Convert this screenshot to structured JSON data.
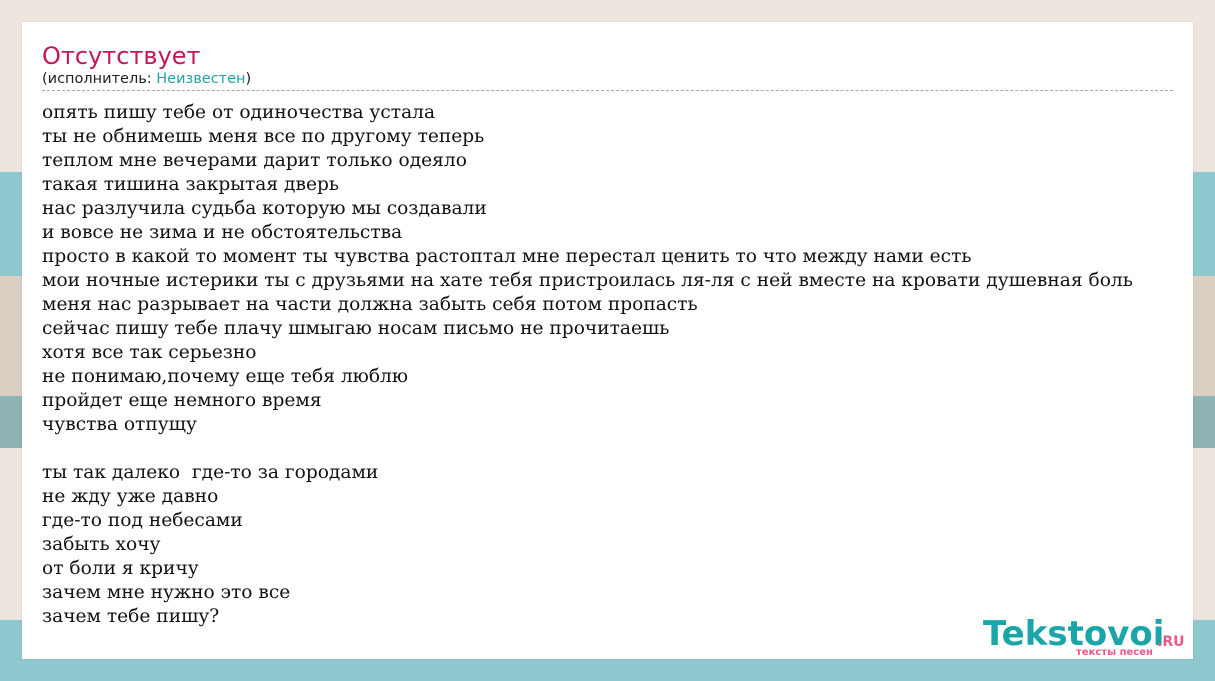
{
  "song": {
    "title": "Отсутствует",
    "artist_prefix": "(исполнитель: ",
    "artist": "Неизвестен",
    "artist_suffix": ")"
  },
  "lyrics": [
    "опять пишу тебе от одиночества устала",
    "ты не обнимешь меня все по другому теперь",
    "теплом мне вечерами дарит только одеяло",
    "такая тишина закрытая дверь",
    "нас разлучила судьба которую мы создавали",
    "и вовсе не зима и не обстоятельства",
    "просто в какой то момент ты чувства растоптал мне перестал ценить то что между нами есть",
    "мои ночные истерики ты с друзьями на хате тебя пристроилась ля-ля с ней вместе на кровати душевная боль",
    "меня нас разрывает на части должна забыть себя потом пропасть",
    "сейчас пишу тебе плачу шмыгаю носам письмо не прочитаешь",
    "хотя все так серьезно",
    "не понимаю,почему еще тебя люблю",
    "пройдет еще немного время",
    "чувства отпущу",
    "",
    "ты так далеко  где-то за городами",
    "не жду уже давно",
    "где-то под небесами",
    "забыть хочу",
    "от боли я кричу",
    "зачем мне нужно это все",
    "зачем тебе пишу?"
  ],
  "logo": {
    "main": "Tekstovoi",
    "domain": ".RU",
    "tagline": "тексты песен"
  },
  "colors": {
    "title": "#c2185b",
    "link": "#26a0a8",
    "logo_main": "#1aa5a8",
    "logo_accent": "#e8578a"
  }
}
